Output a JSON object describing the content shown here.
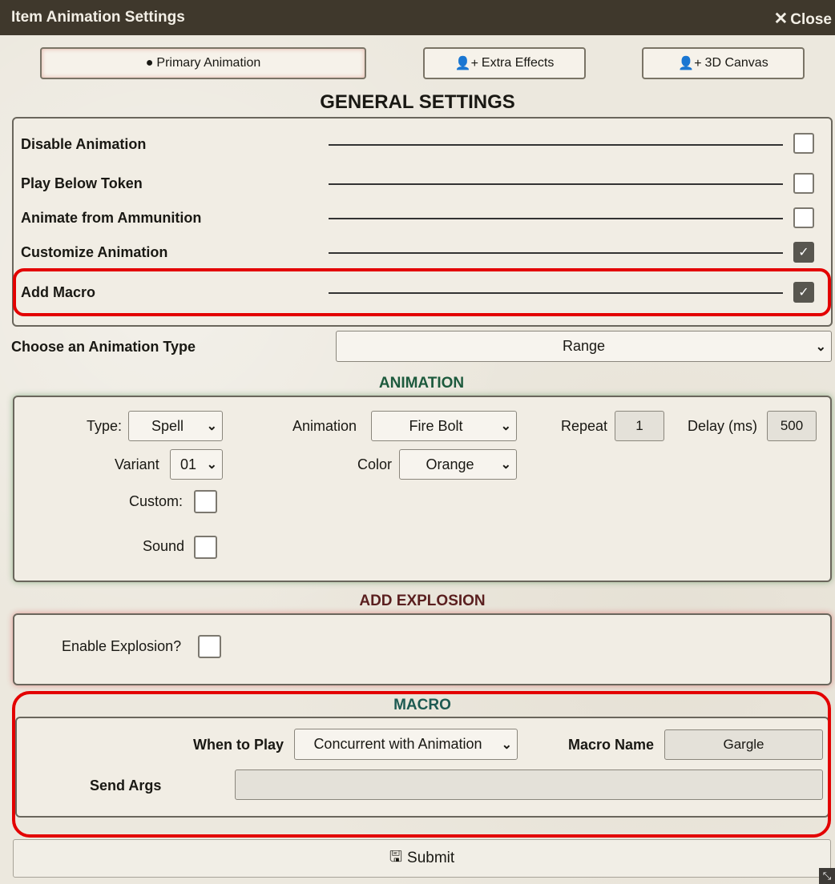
{
  "window": {
    "title": "Item Animation Settings",
    "close_label": "Close"
  },
  "tabs": [
    {
      "label": "Primary Animation",
      "icon": "bomb-icon"
    },
    {
      "label": "Extra Effects",
      "icon": "user-plus-icon"
    },
    {
      "label": "3D Canvas",
      "icon": "user-plus-icon"
    }
  ],
  "general": {
    "title": "GENERAL SETTINGS",
    "rows": [
      {
        "label": "Disable Animation",
        "checked": false
      },
      {
        "label": "Play Below Token",
        "checked": false
      },
      {
        "label": "Animate from Ammunition",
        "checked": false
      },
      {
        "label": "Customize Animation",
        "checked": true
      },
      {
        "label": "Add Macro",
        "checked": true
      }
    ]
  },
  "animation_type": {
    "label": "Choose an Animation Type",
    "value": "Range"
  },
  "animation": {
    "title": "ANIMATION",
    "type_label": "Type:",
    "type_value": "Spell",
    "animation_label": "Animation",
    "animation_value": "Fire Bolt",
    "repeat_label": "Repeat",
    "repeat_value": "1",
    "delay_label": "Delay (ms)",
    "delay_value": "500",
    "variant_label": "Variant",
    "variant_value": "01",
    "color_label": "Color",
    "color_value": "Orange",
    "custom_label": "Custom:",
    "sound_label": "Sound"
  },
  "explosion": {
    "title": "ADD EXPLOSION",
    "enable_label": "Enable Explosion?"
  },
  "macro": {
    "title": "MACRO",
    "when_label": "When to Play",
    "when_value": "Concurrent with Animation",
    "name_label": "Macro Name",
    "name_value": "Gargle",
    "args_label": "Send Args",
    "args_value": ""
  },
  "submit_label": "Submit",
  "colors": {
    "titlebar": "#3f382c",
    "highlight": "#e30000",
    "animation_glow": "#2e7d32",
    "explosion_glow": "#d32f2f"
  }
}
